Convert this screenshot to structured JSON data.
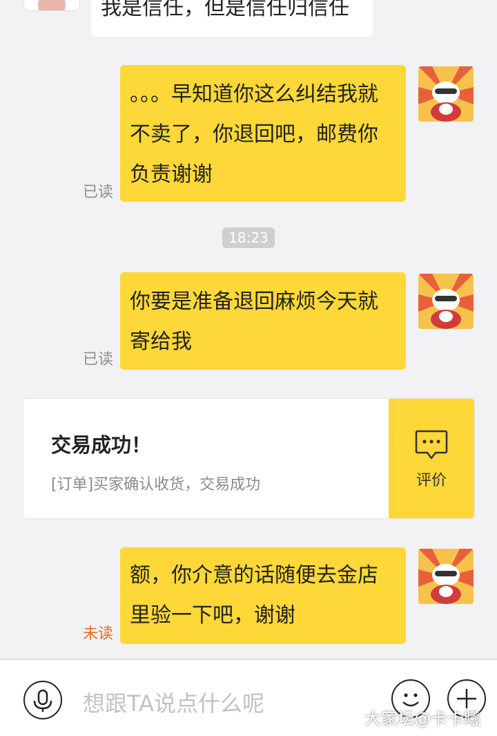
{
  "messages": [
    {
      "text": "我是信任，但是信任归信任"
    },
    {
      "text": "。。。早知道你这么纠结我就不卖了，你退回吧，邮费你负责谢谢",
      "status": "已读"
    },
    {
      "text": "你要是准备退回麻烦今天就寄给我",
      "status": "已读"
    },
    {
      "text": "额，你介意的话随便去金店里验一下吧，谢谢",
      "status": "未读"
    }
  ],
  "timestamp": "18:23",
  "trade_card": {
    "title": "交易成功！",
    "subtitle": "[订单]买家确认收货，交易成功",
    "action_label": "评价"
  },
  "input": {
    "placeholder": "想跟TA说点什么呢"
  },
  "watermark": "大家坛@卡卡曦",
  "colors": {
    "bubble": "#fdd838",
    "unread": "#ee6a22",
    "read": "#8f8f8f"
  },
  "icons": [
    "microphone-icon",
    "emoji-icon",
    "plus-icon",
    "comment-icon"
  ]
}
